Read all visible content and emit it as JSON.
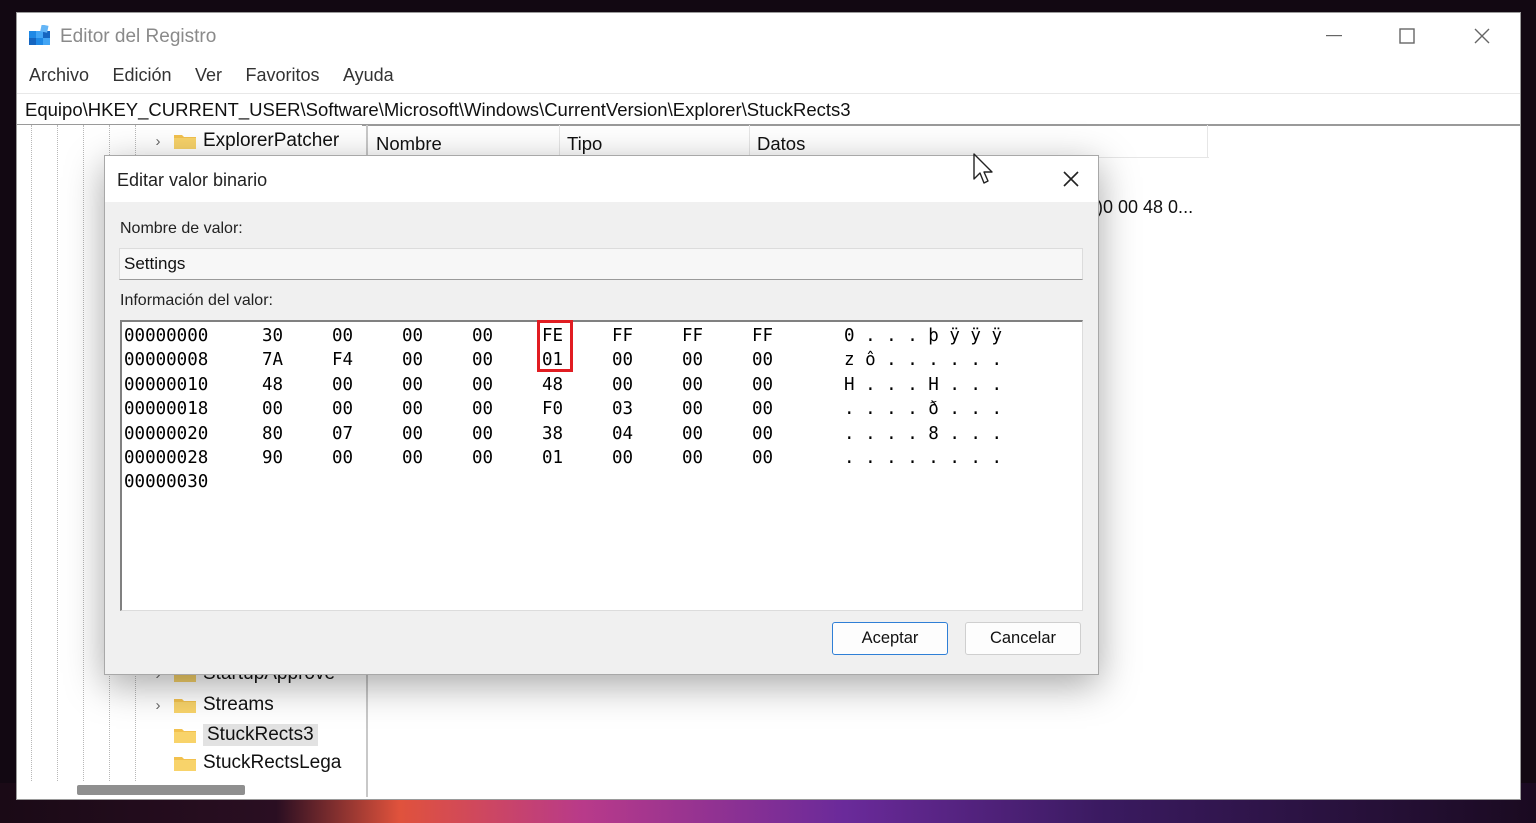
{
  "window": {
    "title": "Editor del Registro",
    "minimize_label": "—",
    "maximize_label": "☐",
    "close_label": "✕"
  },
  "menu": [
    "Archivo",
    "Edición",
    "Ver",
    "Favoritos",
    "Ayuda"
  ],
  "address": "Equipo\\HKEY_CURRENT_USER\\Software\\Microsoft\\Windows\\CurrentVersion\\Explorer\\StuckRects3",
  "tree": {
    "items": [
      {
        "label": "ExplorerPatcher",
        "expanded": false
      },
      {
        "label": "StartupApprove",
        "expanded": false
      },
      {
        "label": "Streams",
        "expanded": false
      },
      {
        "label": "StuckRects3",
        "selected": true
      },
      {
        "label": "StuckRectsLega",
        "expanded": false
      }
    ]
  },
  "list": {
    "columns": [
      "Nombre",
      "Tipo",
      "Datos"
    ],
    "data_peek": ")0 00 48 0..."
  },
  "dialog": {
    "title": "Editar valor binario",
    "name_label": "Nombre de valor:",
    "name_value": "Settings",
    "info_label": "Información del valor:",
    "rows": [
      {
        "offset": "00000000",
        "bytes": [
          "30",
          "00",
          "00",
          "00",
          "FE",
          "FF",
          "FF",
          "FF"
        ],
        "ascii": "0 . . . þ ÿ ÿ ÿ"
      },
      {
        "offset": "00000008",
        "bytes": [
          "7A",
          "F4",
          "00",
          "00",
          "01",
          "00",
          "00",
          "00"
        ],
        "ascii": "z ô . . . . . ."
      },
      {
        "offset": "00000010",
        "bytes": [
          "48",
          "00",
          "00",
          "00",
          "48",
          "00",
          "00",
          "00"
        ],
        "ascii": "H . . . H . . ."
      },
      {
        "offset": "00000018",
        "bytes": [
          "00",
          "00",
          "00",
          "00",
          "F0",
          "03",
          "00",
          "00"
        ],
        "ascii": ". . . . ð . . ."
      },
      {
        "offset": "00000020",
        "bytes": [
          "80",
          "07",
          "00",
          "00",
          "38",
          "04",
          "00",
          "00"
        ],
        "ascii": ". . . . 8 . . ."
      },
      {
        "offset": "00000028",
        "bytes": [
          "90",
          "00",
          "00",
          "00",
          "01",
          "00",
          "00",
          "00"
        ],
        "ascii": ". . . . . . . ."
      },
      {
        "offset": "00000030",
        "bytes": [],
        "ascii": ""
      }
    ],
    "ok_label": "Aceptar",
    "cancel_label": "Cancelar",
    "close_label": "✕"
  },
  "colors": {
    "highlight": "#e11d22",
    "primary_button_border": "#2f7fd6",
    "folder": "#f2c14e"
  }
}
